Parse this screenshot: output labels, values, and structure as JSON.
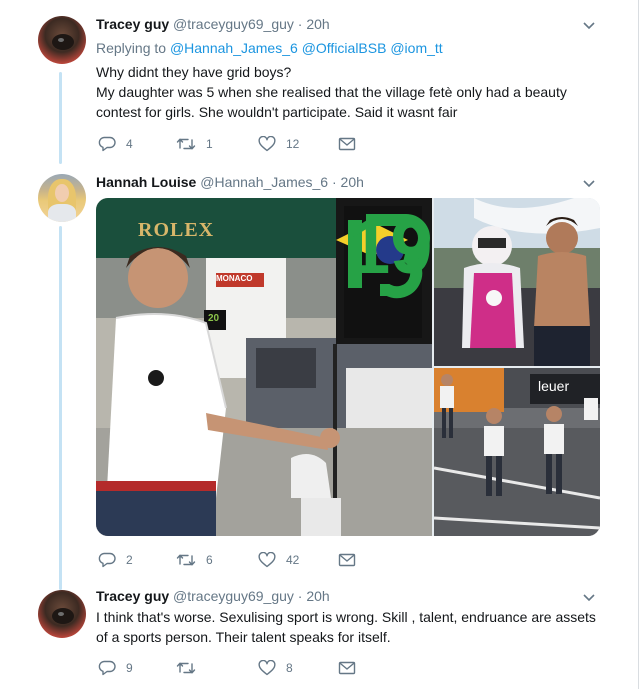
{
  "tweets": [
    {
      "name": "Tracey guy",
      "handle": "@traceyguy69_guy",
      "time": "· 20h",
      "replying_prefix": "Replying to",
      "replying_to": [
        "@Hannah_James_6",
        "@OfficialBSB",
        "@iom_tt"
      ],
      "lines": [
        "Why didnt they have grid boys?",
        "My daughter was 5 when she realised that the village fetè only had a beauty",
        "contest for girls. She wouldn't participate. Said it wasnt fair"
      ],
      "replies": "4",
      "retweets": "1",
      "likes": "12"
    },
    {
      "name": "Hannah Louise",
      "handle": "@Hannah_James_6",
      "time": "· 20h",
      "media_text": {
        "rolex": "ROLEX",
        "number": "19",
        "banner": "MONACO",
        "small_board": "20",
        "shop": "leuer"
      },
      "replies": "2",
      "retweets": "6",
      "likes": "42"
    },
    {
      "name": "Tracey guy",
      "handle": "@traceyguy69_guy",
      "time": "· 20h",
      "lines": [
        "I think that's worse. Sexulising sport is wrong. Skill , talent, endruance are assets",
        "of a sports person.  Their talent speaks for itself."
      ],
      "replies": "9",
      "retweets": "",
      "likes": "8"
    }
  ],
  "icons": {
    "reply": "reply-icon",
    "retweet": "retweet-icon",
    "like": "heart-icon",
    "message": "envelope-icon",
    "caret": "chevron-down-icon"
  },
  "colors": {
    "text": "#14171a",
    "muted": "#657786",
    "link": "#1b95e0",
    "thread": "#c4e2f4"
  }
}
